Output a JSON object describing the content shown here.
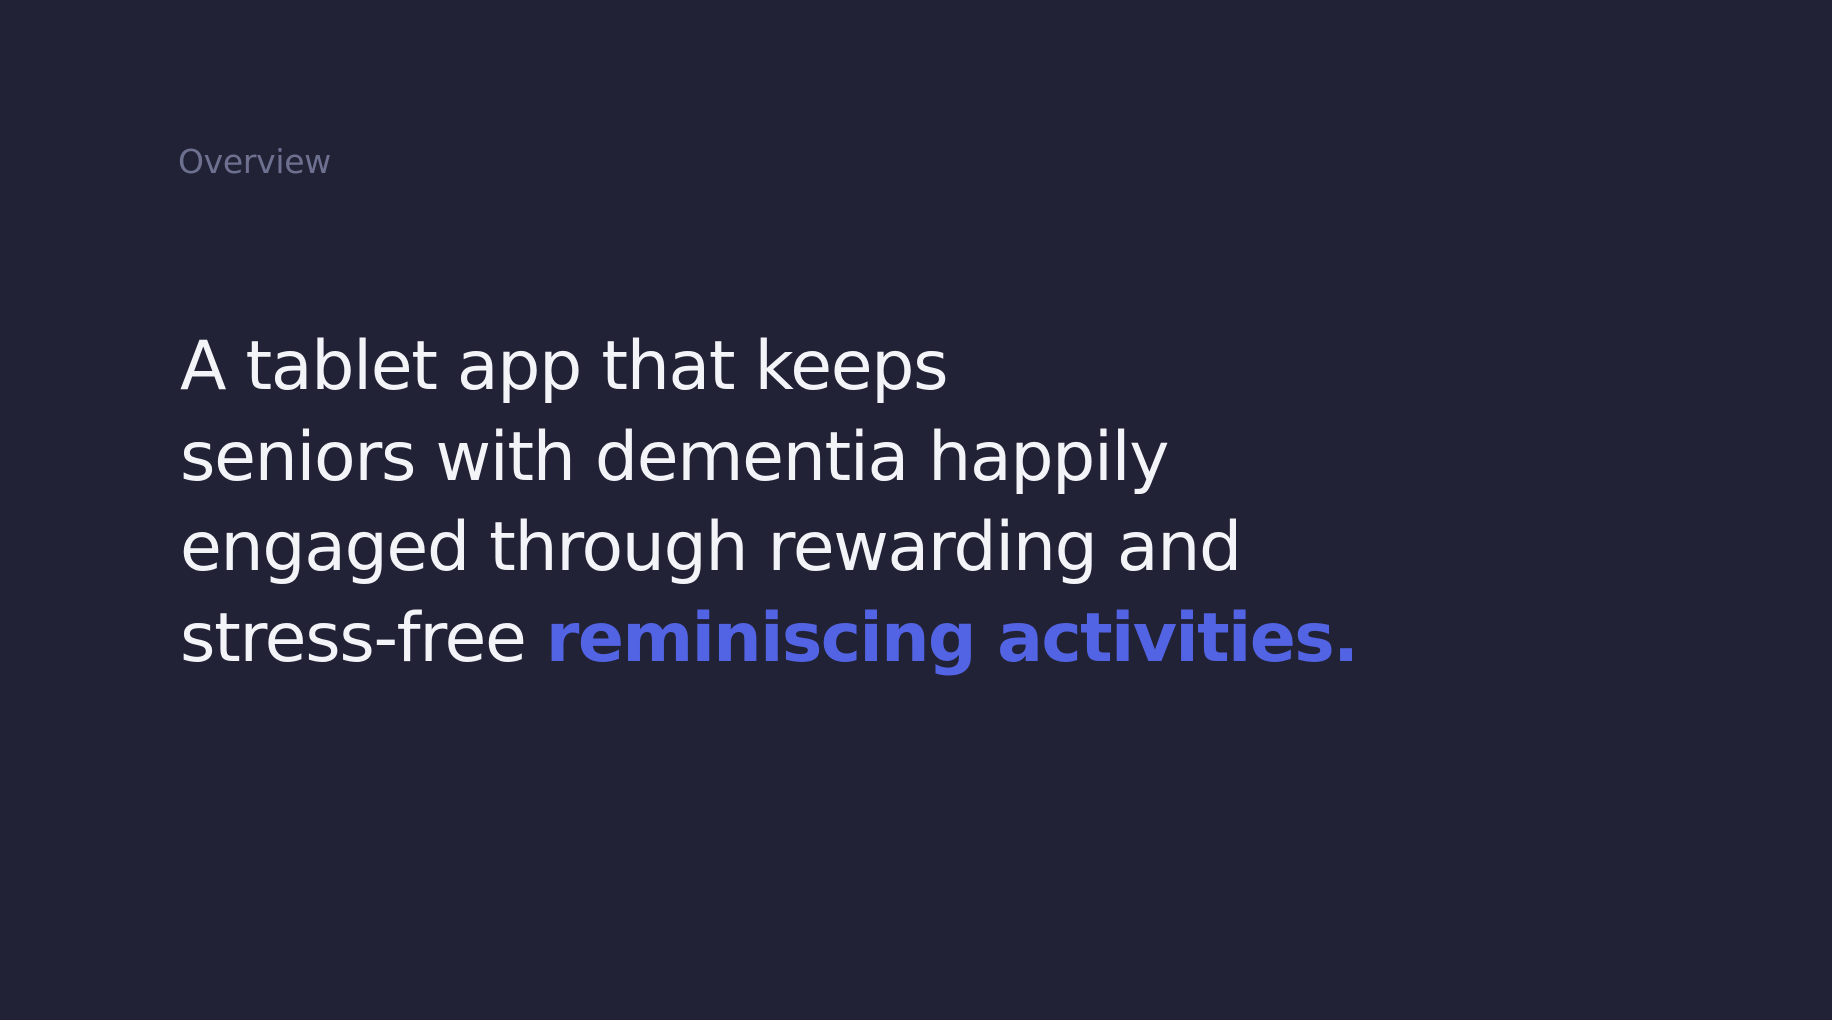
{
  "section": {
    "label": "Overview"
  },
  "headline": {
    "line1": "A tablet app that keeps",
    "line2": "seniors with dementia happily",
    "line3": "engaged through rewarding and",
    "line4_plain": "stress-free",
    "line4_highlight": "reminiscing activities."
  },
  "colors": {
    "background": "#212236",
    "label": "#6e7090",
    "text": "#f3f4f8",
    "accent": "#5264e3"
  }
}
